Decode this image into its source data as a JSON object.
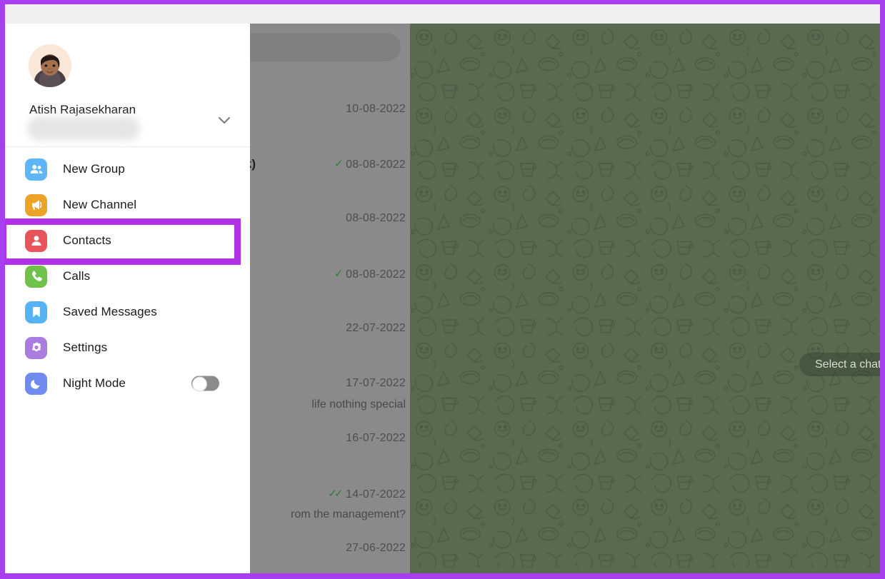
{
  "window": {
    "highlight_color": "#b232e8",
    "titlebar_color": "#efefef"
  },
  "menu": {
    "profile": {
      "name": "Atish Rajasekharan",
      "phone_redacted": true,
      "chevron_icon": "chevron-down-icon",
      "avatar_icon": "user-avatar-photo"
    },
    "items": [
      {
        "label": "New Group",
        "icon": "new-group-icon",
        "color": "#5eb5f7"
      },
      {
        "label": "New Channel",
        "icon": "new-channel-icon",
        "color": "#eda32a"
      },
      {
        "label": "Contacts",
        "icon": "contacts-icon",
        "color": "#e8545b"
      },
      {
        "label": "Calls",
        "icon": "calls-icon",
        "color": "#6fc24a"
      },
      {
        "label": "Saved Messages",
        "icon": "saved-messages-icon",
        "color": "#55b3f3"
      },
      {
        "label": "Settings",
        "icon": "settings-icon",
        "color": "#ab7ce0"
      },
      {
        "label": "Night Mode",
        "icon": "night-mode-icon",
        "color": "#6f8bf0"
      }
    ],
    "night_mode": {
      "enabled": false
    }
  },
  "chatlist": {
    "search_placeholder": "",
    "rows": [
      {
        "date": "10-08-2022",
        "ticks": 0,
        "title_fragment": "",
        "preview_fragment": ""
      },
      {
        "date": "08-08-2022",
        "ticks": 1,
        "title_fragment": "k)",
        "preview_fragment": ""
      },
      {
        "date": "08-08-2022",
        "ticks": 0,
        "title_fragment": "",
        "preview_fragment": ""
      },
      {
        "date": "08-08-2022",
        "ticks": 1,
        "title_fragment": "",
        "preview_fragment": ""
      },
      {
        "date": "22-07-2022",
        "ticks": 0,
        "title_fragment": "",
        "preview_fragment": ""
      },
      {
        "date": "17-07-2022",
        "ticks": 0,
        "title_fragment": "",
        "preview_fragment": "life nothing special"
      },
      {
        "date": "16-07-2022",
        "ticks": 0,
        "title_fragment": "",
        "preview_fragment": ""
      },
      {
        "date": "14-07-2022",
        "ticks": 2,
        "title_fragment": "",
        "preview_fragment": "rom the management?"
      },
      {
        "date": "27-06-2022",
        "ticks": 0,
        "title_fragment": "",
        "preview_fragment": ""
      }
    ]
  },
  "rightpane": {
    "placeholder_text": "Select a chat t",
    "background_color": "#596a51"
  }
}
